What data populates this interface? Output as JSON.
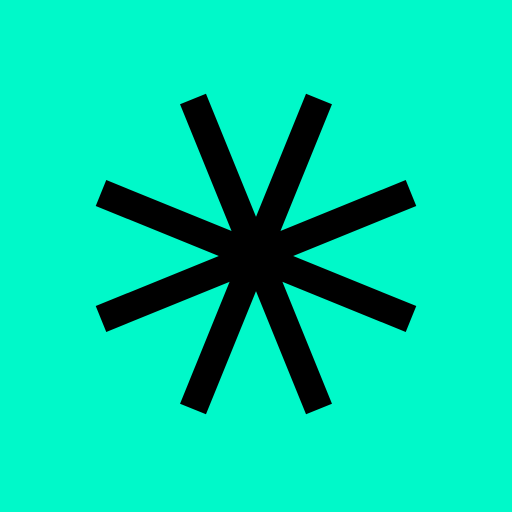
{
  "icon": {
    "name": "asterisk-icon",
    "background_color": "#00F9C9",
    "stroke_color": "#000000"
  }
}
